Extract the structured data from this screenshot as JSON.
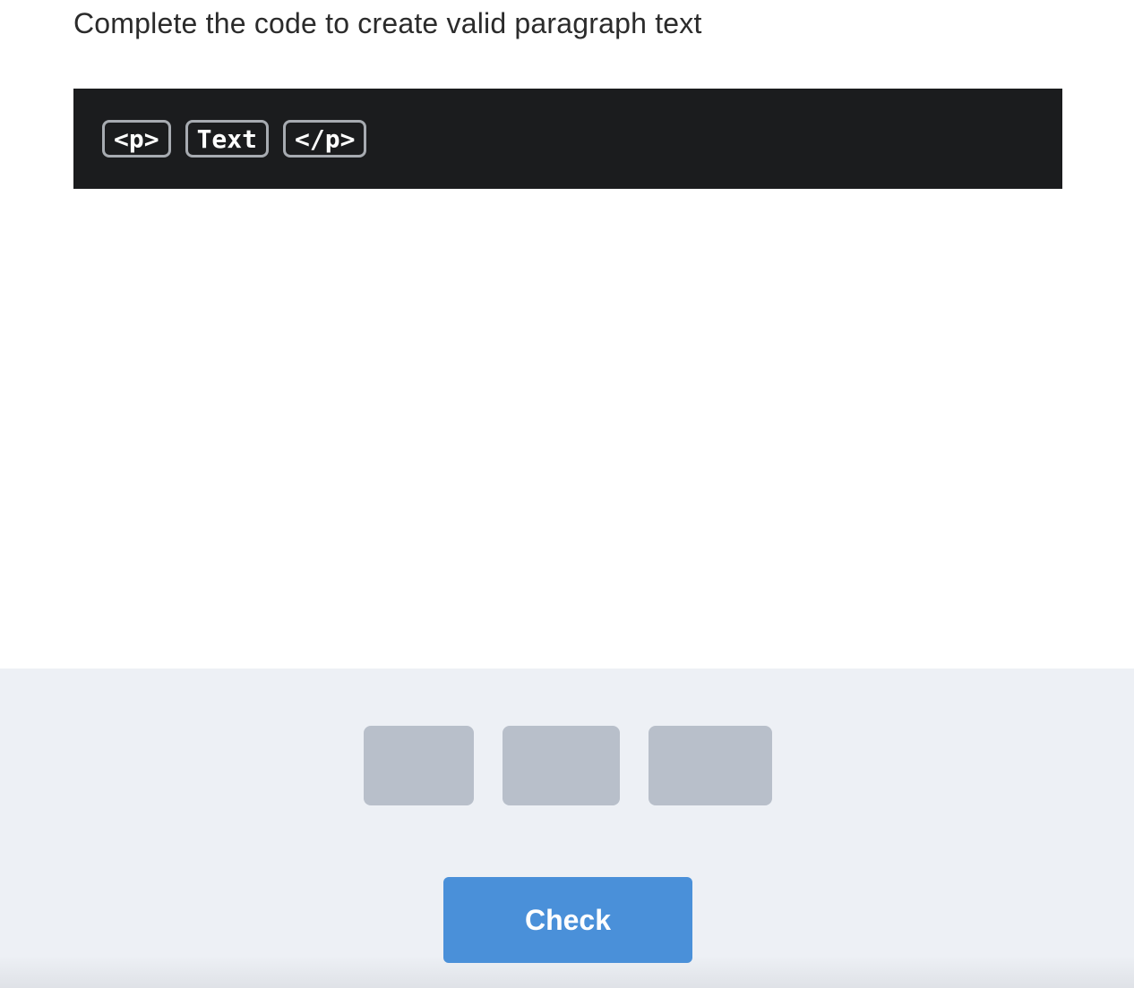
{
  "prompt": "Complete the code to create valid paragraph text",
  "code_tokens": [
    {
      "label": "<p>"
    },
    {
      "label": "Text"
    },
    {
      "label": "</p>"
    }
  ],
  "answer_slots": [
    {
      "label": ""
    },
    {
      "label": ""
    },
    {
      "label": ""
    }
  ],
  "check_button": {
    "label": "Check"
  },
  "colors": {
    "code_background": "#1b1c1e",
    "token_border": "#a7abb1",
    "tray_background": "#edf0f5",
    "slot_placeholder": "#b8bfca",
    "check_button": "#4a90d9"
  }
}
